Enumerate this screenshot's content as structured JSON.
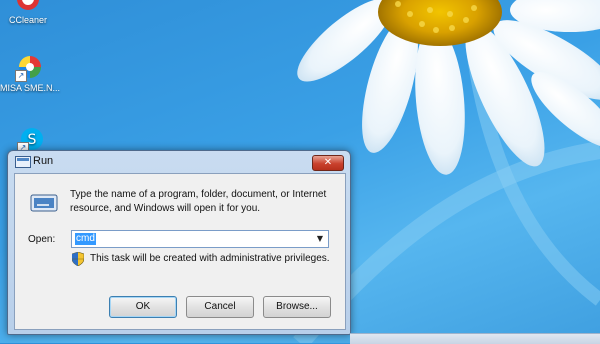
{
  "desktop": {
    "icons": [
      {
        "label": "CCleaner",
        "icon": "ccleaner-icon"
      },
      {
        "label": "MISA SME.N...",
        "icon": "misa-icon"
      },
      {
        "label": "",
        "icon": "skype-icon"
      }
    ]
  },
  "run_dialog": {
    "title": "Run",
    "description": "Type the name of a program, folder, document, or Internet resource, and Windows will open it for you.",
    "open_label": "Open:",
    "open_value": "cmd",
    "admin_note": "This task will be created with administrative privileges.",
    "buttons": {
      "ok": "OK",
      "cancel": "Cancel",
      "browse": "Browse..."
    },
    "close_icon": "close-icon"
  },
  "colors": {
    "wallpaper_blue": "#3aa0e6",
    "close_red": "#c9412d",
    "selection_blue": "#3399ff"
  }
}
